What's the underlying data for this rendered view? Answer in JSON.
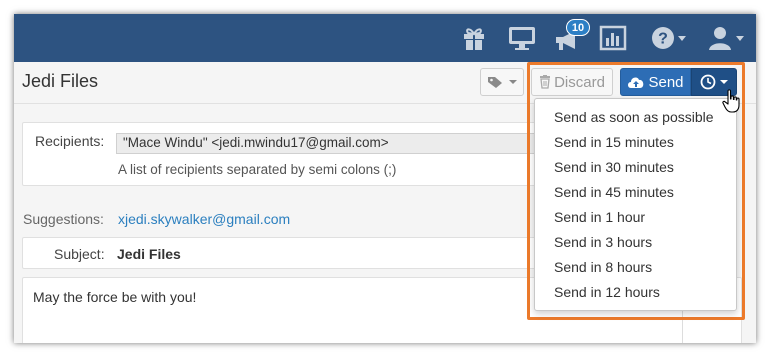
{
  "topbar": {
    "icons": [
      "gift-icon",
      "monitor-icon",
      "megaphone-icon",
      "bar-chart-icon",
      "help-icon",
      "user-icon"
    ],
    "notification_count": "10",
    "background_color": "#2d5381"
  },
  "header": {
    "title": "Jedi Files",
    "discard_label": "Discard",
    "send_label": "Send",
    "send_button_color": "#2d6db5"
  },
  "form": {
    "recipients_label": "Recipients:",
    "recipients_value": "\"Mace Windu\" <jedi.mwindu17@gmail.com>",
    "recipients_hint": "A list of recipients separated by semi colons (;)",
    "suggestions_label": "Suggestions:",
    "suggestion": "xjedi.skywalker@gmail.com",
    "subject_label": "Subject:",
    "subject_value": "Jedi Files",
    "body": "May the force be with you!"
  },
  "schedule_menu": {
    "highlight_color": "#ec7a2b",
    "items": [
      "Send as soon as possible",
      "Send in 15 minutes",
      "Send in 30 minutes",
      "Send in 45 minutes",
      "Send in 1 hour",
      "Send in 3 hours",
      "Send in 8 hours",
      "Send in 12 hours"
    ]
  }
}
